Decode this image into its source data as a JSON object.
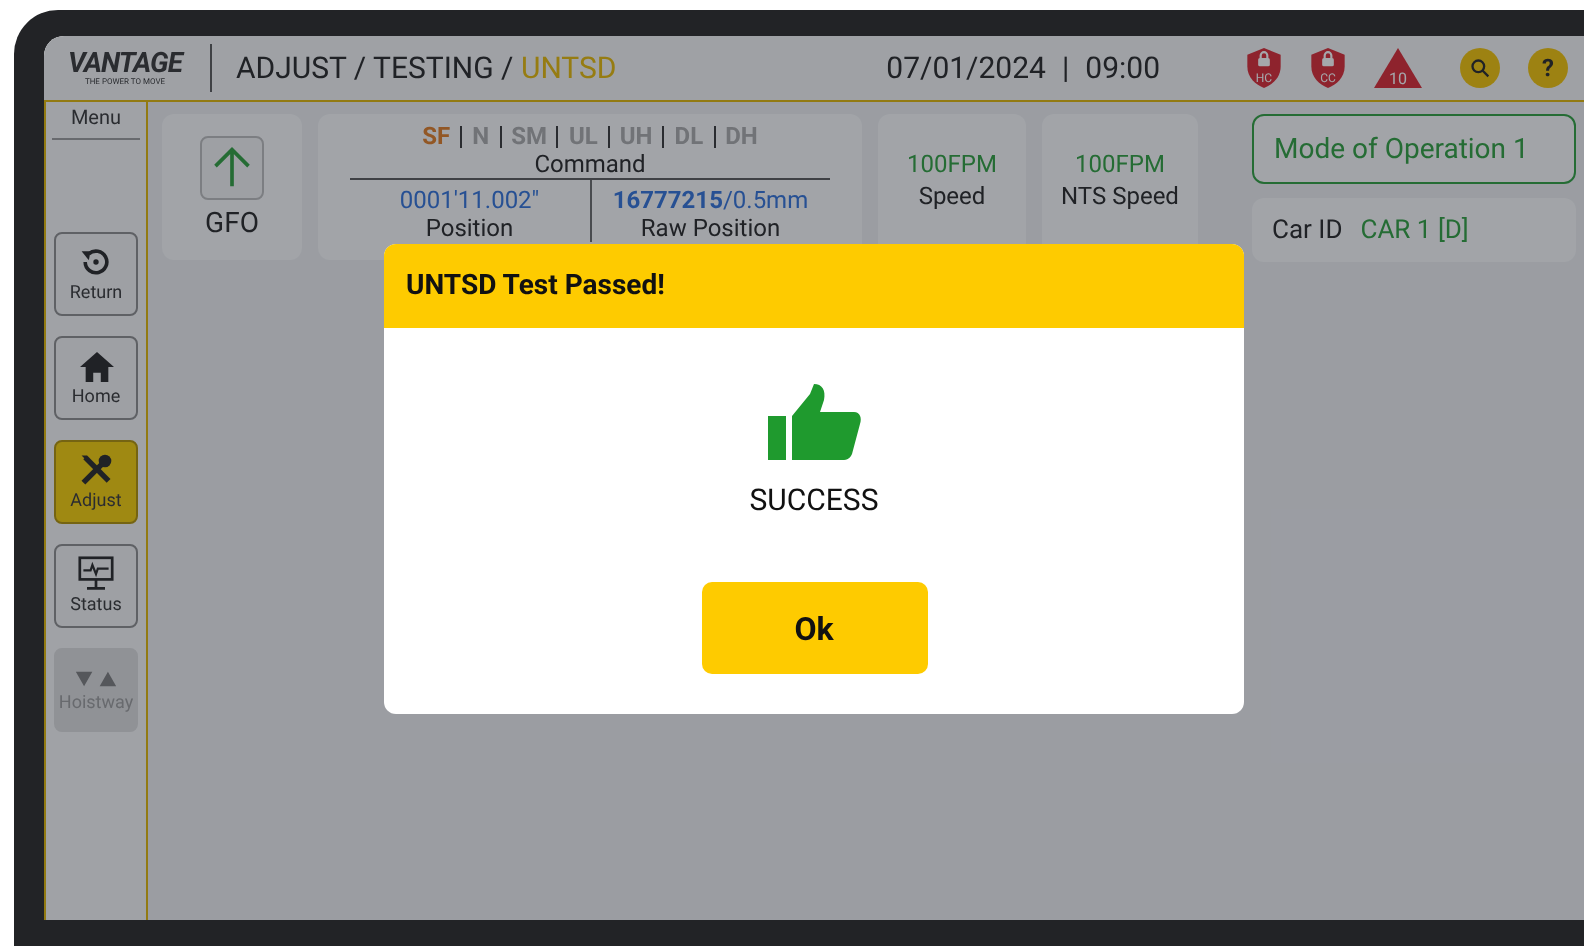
{
  "header": {
    "logo": "VANTAGE",
    "logo_tagline": "THE POWER TO MOVE",
    "breadcrumb": [
      {
        "label": "ADJUST / TESTING / ",
        "current": false
      },
      {
        "label": "UNTSD",
        "current": true
      }
    ],
    "date": "07/01/2024",
    "separator": "|",
    "time": "09:00",
    "indicators": [
      {
        "kind": "shield",
        "label": "HC"
      },
      {
        "kind": "shield",
        "label": "CC"
      },
      {
        "kind": "triangle",
        "label": "10"
      },
      {
        "kind": "search"
      },
      {
        "kind": "help",
        "label": "?"
      }
    ]
  },
  "sidebar": {
    "title": "Menu",
    "items": [
      {
        "kind": "return",
        "label": "Return",
        "selected": false,
        "disabled": false
      },
      {
        "kind": "home",
        "label": "Home",
        "selected": false,
        "disabled": false
      },
      {
        "kind": "adjust",
        "label": "Adjust",
        "selected": true,
        "disabled": false
      },
      {
        "kind": "status",
        "label": "Status",
        "selected": false,
        "disabled": false
      },
      {
        "kind": "hoistway",
        "label": "Hoistway",
        "selected": false,
        "disabled": true
      }
    ]
  },
  "direction": {
    "label": "GFO"
  },
  "command": {
    "flags": [
      {
        "label": "SF",
        "on": true
      },
      {
        "label": "N",
        "on": false
      },
      {
        "label": "SM",
        "on": false
      },
      {
        "label": "UL",
        "on": false
      },
      {
        "label": "UH",
        "on": false
      },
      {
        "label": "DL",
        "on": false
      },
      {
        "label": "DH",
        "on": false
      }
    ],
    "title": "Command",
    "position": {
      "value": "0001'11.002\"",
      "label": "Position"
    },
    "raw_position": {
      "value": "**16777215**/0.5mm",
      "label": "Raw Position"
    }
  },
  "speeds": [
    {
      "value": "100FPM",
      "label": "Speed"
    },
    {
      "value": "100FPM",
      "label": "NTS Speed"
    }
  ],
  "mode": "Mode of Operation 1",
  "car": {
    "label": "Car ID",
    "value": "CAR 1 [D]"
  },
  "dialog": {
    "title": "UNTSD Test Passed!",
    "message": "SUCCESS",
    "button": "Ok"
  }
}
